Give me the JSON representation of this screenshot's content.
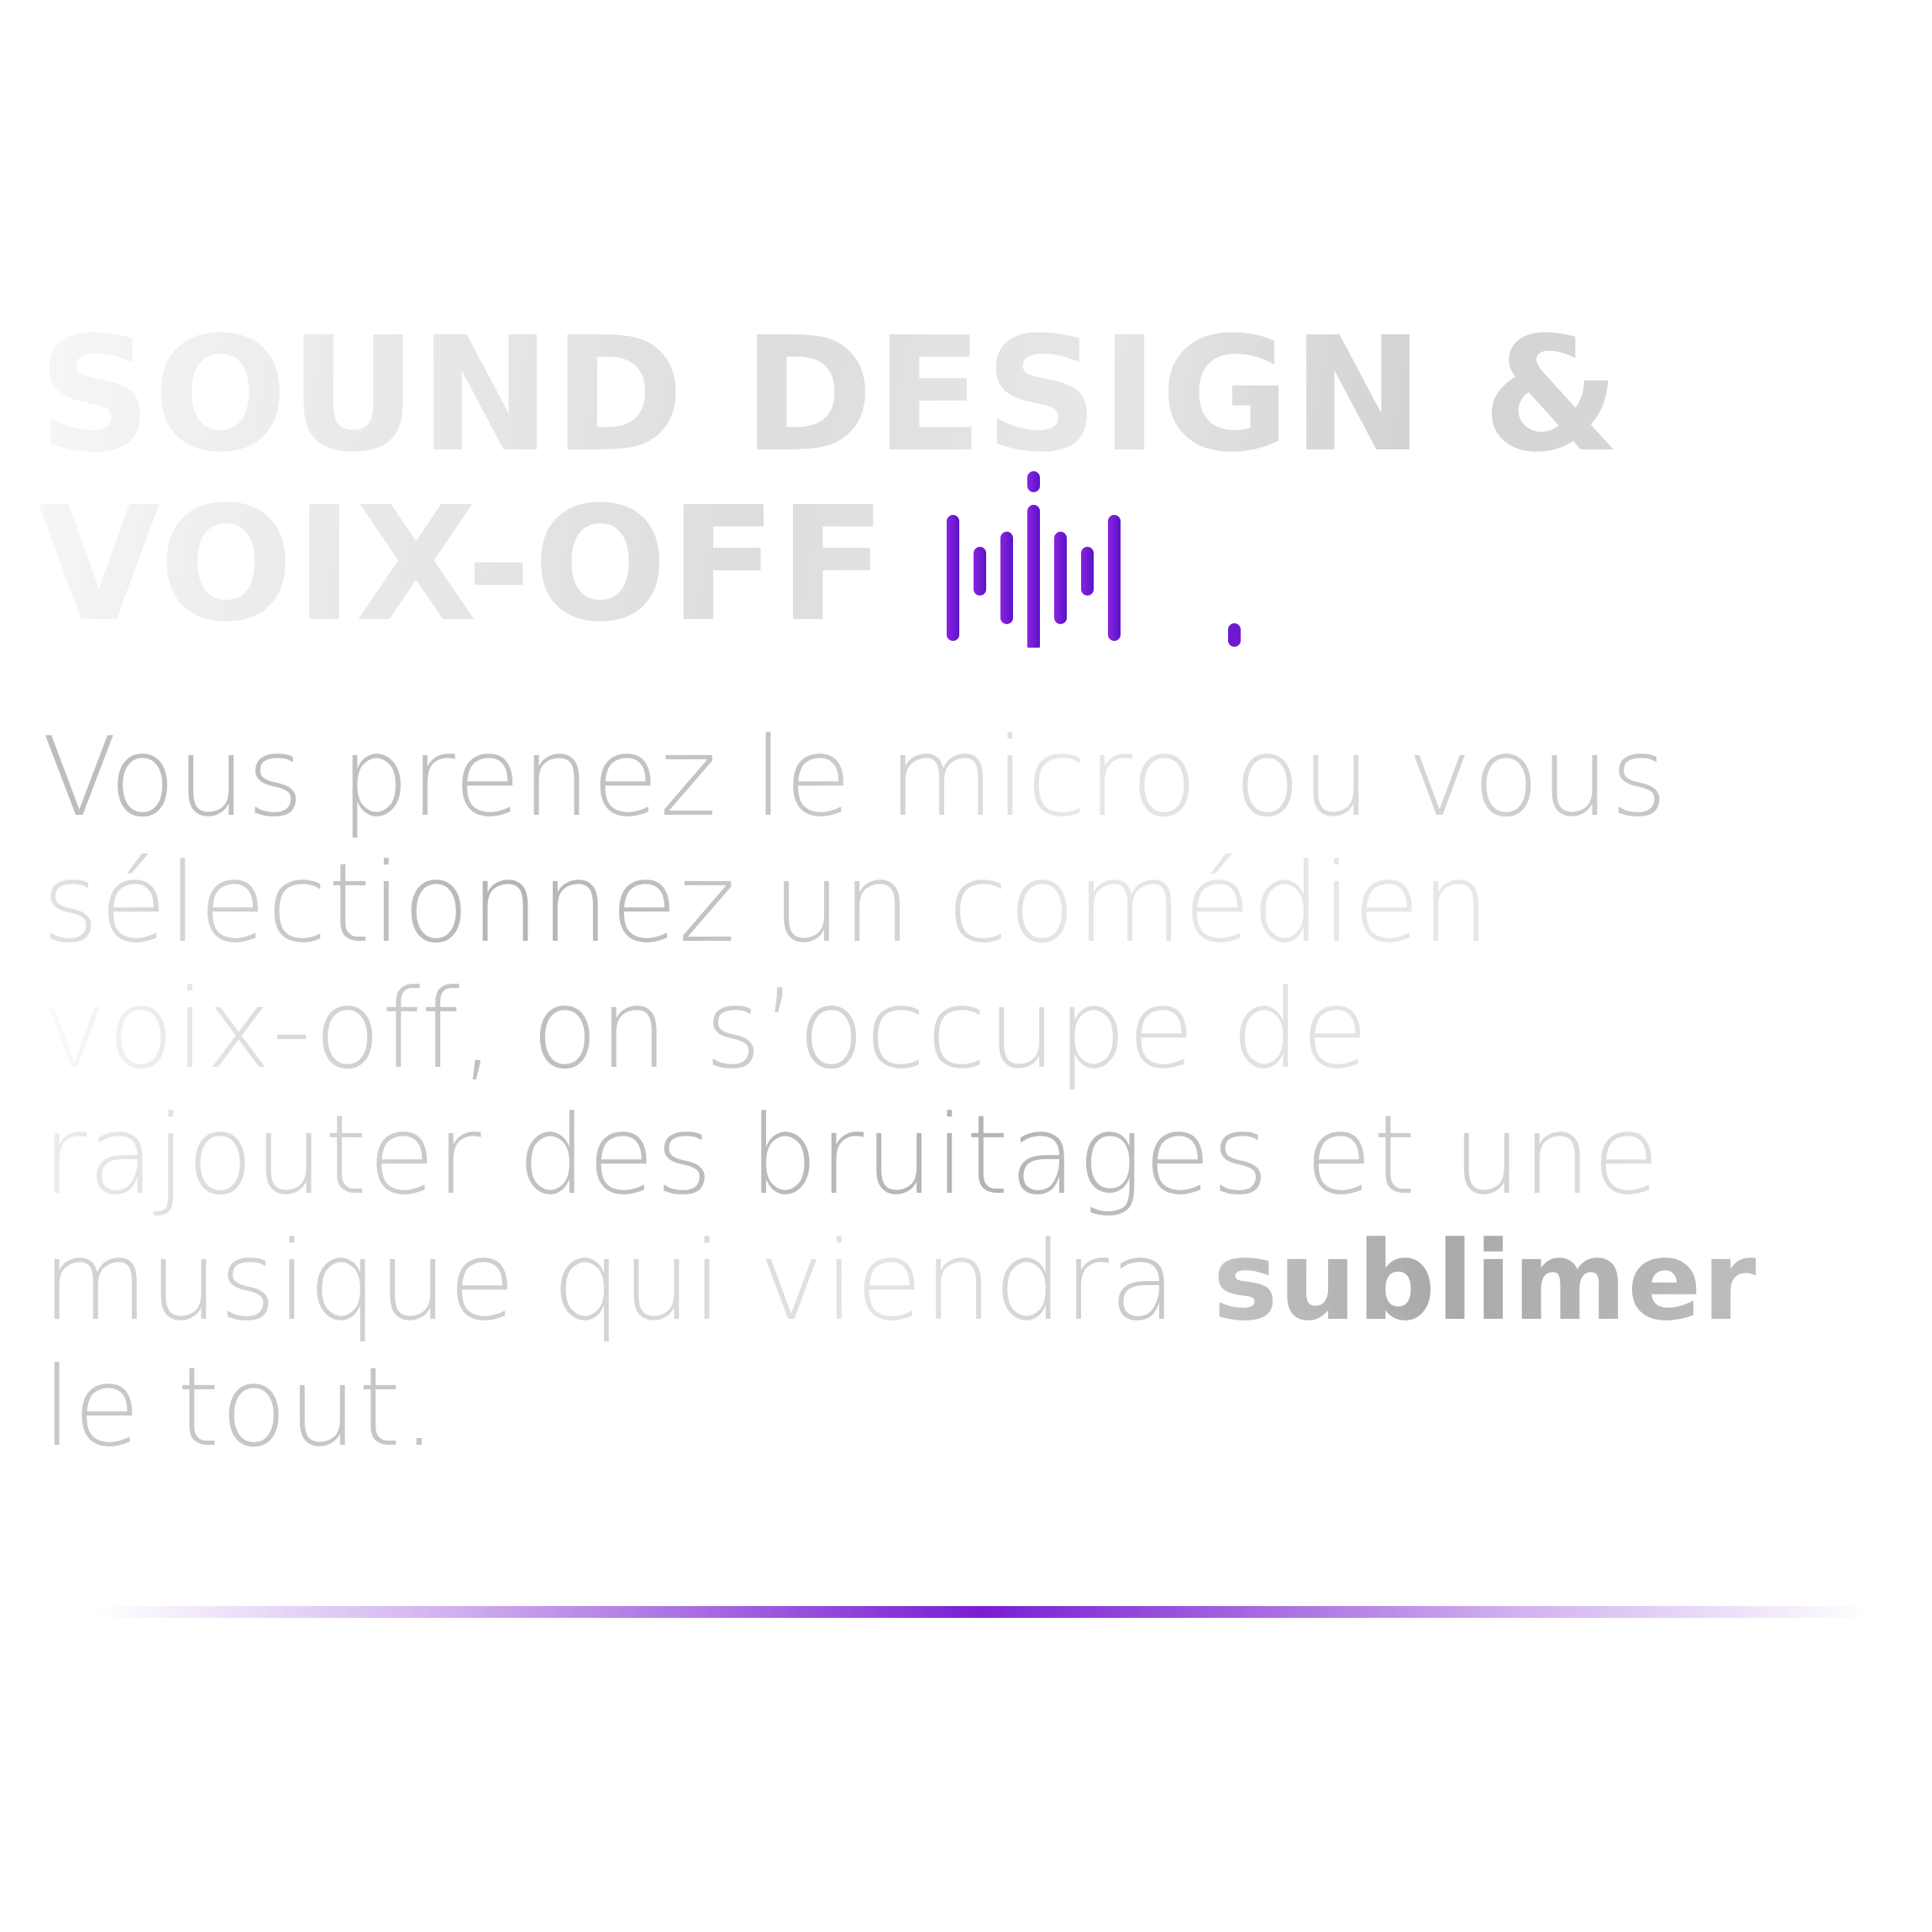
{
  "title": {
    "line1": "SOUND DESIGN &",
    "line2": "VOIX-OFF"
  },
  "icon": "sound-waveform-icon",
  "colors": {
    "accent": "#7a1dd2",
    "title_gray": "#e0e0e0",
    "body_gray": "#c9c9c9",
    "emphasis_gray": "#a8a8a8"
  },
  "body": {
    "line1": "Vous prenez le micro ou vous",
    "line2": "sélectionnez un comédien",
    "line3": "voix-off, on s’occupe de",
    "line4": "rajouter des bruitages et une",
    "line5_before": "musique qui viendra ",
    "line5_emphasis": "sublimer",
    "line6": "le tout."
  }
}
